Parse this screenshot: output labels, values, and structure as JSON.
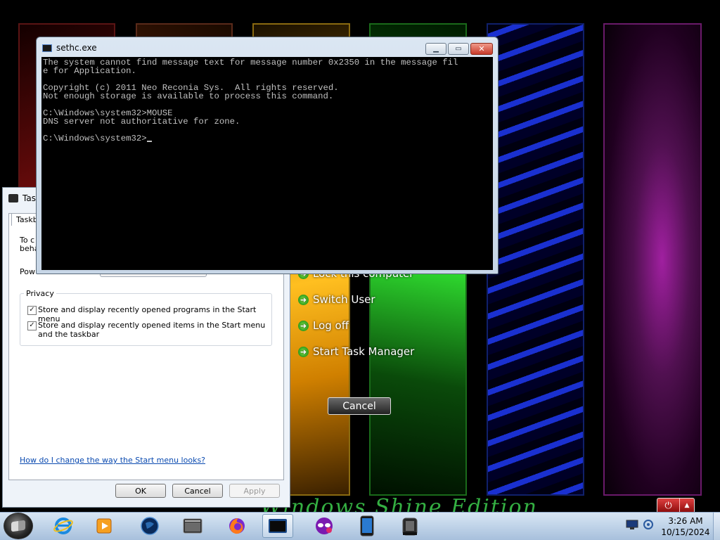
{
  "colors": {
    "console_bg": "#000000",
    "console_text": "#c0c0c0",
    "link": "#0a4ab0",
    "watermark": "#3ac24a",
    "security_option_arrow": "#2a9a1a"
  },
  "console": {
    "title": "sethc.exe",
    "lines": [
      "The system cannot find message text for message number 0x2350 in the message fil",
      "e for Application.",
      "",
      "Copyright (c) 2011 Neo Reconia Sys.  All rights reserved.",
      "Not enough storage is available to process this command.",
      "",
      "C:\\Windows\\system32>MOUSE",
      "DNS server not authoritative for zone.",
      ""
    ],
    "prompt": "C:\\Windows\\system32>",
    "controls": {
      "minimize": "minimize-icon",
      "maximize": "maximize-icon",
      "close": "close-icon"
    }
  },
  "taskbar_props": {
    "title": "Tas",
    "tab": "Taskb",
    "intro_line1": "To c",
    "intro_line2": "beha",
    "power_label": "Pow",
    "privacy_label": "Privacy",
    "checkboxes": [
      {
        "label": "Store and display recently opened programs in the Start menu",
        "checked": true
      },
      {
        "label": "Store and display recently opened items in the Start menu and the taskbar",
        "checked": true
      }
    ],
    "help_link": "How do I change the way the Start menu looks?",
    "buttons": {
      "ok": "OK",
      "cancel": "Cancel",
      "apply": "Apply"
    }
  },
  "security_screen": {
    "partial_option": "Lock this computer",
    "options": [
      "Switch User",
      "Log off",
      "Start Task Manager"
    ],
    "cancel": "Cancel",
    "watermark": "Windows Shine Edition"
  },
  "taskbar": {
    "pinned": [
      "start-orb",
      "internet-explorer-icon",
      "media-player-icon",
      "globe-icon",
      "explorer-window-icon",
      "firefox-icon",
      "console-window-icon",
      "masks-icon",
      "tablet-icon",
      "task-manager-icon"
    ],
    "active_index": 6,
    "time": "3:26 AM",
    "date": "10/15/2024"
  }
}
